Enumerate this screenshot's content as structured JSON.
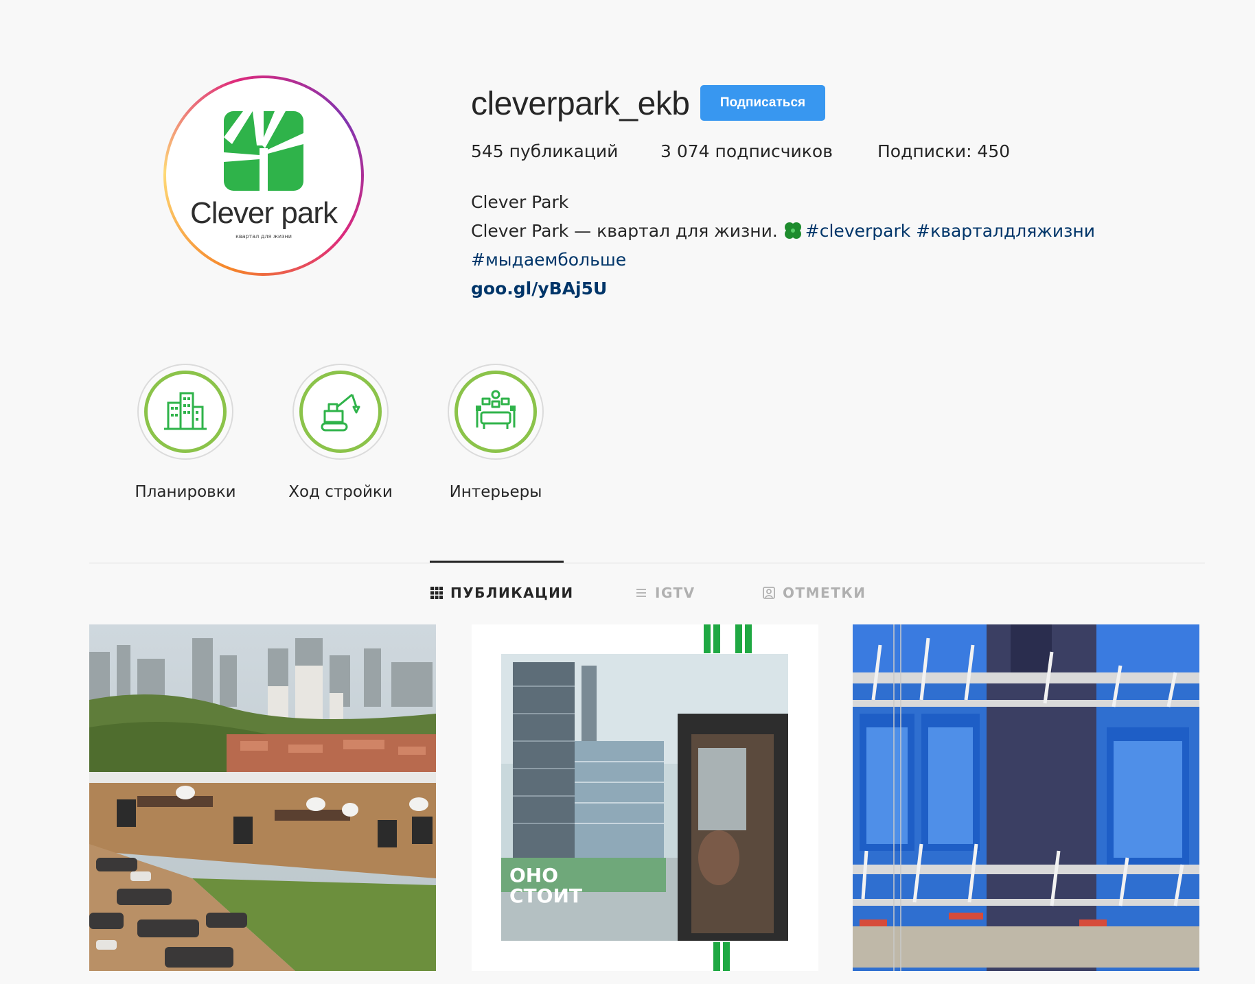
{
  "profile": {
    "username": "cleverpark_ekb",
    "follow_label": "Подписаться",
    "stats": {
      "posts": "545 публикаций",
      "followers": "3 074 подписчиков",
      "following": "Подписки: 450"
    },
    "bio": {
      "name": "Clever Park",
      "text": "Clever Park — квартал для жизни.",
      "hashtag1": "#cleverpark",
      "hashtag2": "#кварталдляжизни",
      "hashtag3": "#мыдаембольше",
      "link": "goo.gl/yBAj5U"
    },
    "avatar": {
      "brand": "Clever park",
      "tagline": "квартал для жизни",
      "brand_color": "#2fb34a"
    }
  },
  "highlights": [
    {
      "label": "Планировки",
      "icon": "buildings-icon"
    },
    {
      "label": "Ход стройки",
      "icon": "excavator-icon"
    },
    {
      "label": "Интерьеры",
      "icon": "interior-icon"
    }
  ],
  "tabs": [
    {
      "label": "ПУБЛИКАЦИИ",
      "icon": "grid-icon",
      "active": true
    },
    {
      "label": "IGTV",
      "icon": "igtv-icon",
      "active": false
    },
    {
      "label": "ОТМЕТКИ",
      "icon": "tag-icon",
      "active": false
    }
  ],
  "posts": [
    {
      "description": "rooftop-terrace-photo"
    },
    {
      "description": "city-buildings-photo",
      "overlay": "ОНО\nСТОИТ"
    },
    {
      "description": "facade-construction-photo"
    }
  ],
  "colors": {
    "accent_blue": "#3897f0",
    "hashtag": "#003569",
    "highlight_ring": "#8bc34a",
    "brand_green": "#2fb34a"
  }
}
